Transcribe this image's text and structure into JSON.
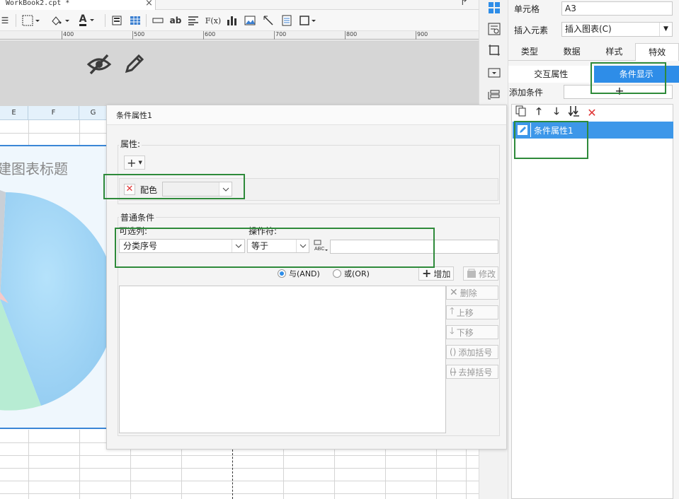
{
  "file_tab": {
    "name": "WorkBook2.cpt *",
    "close": "×"
  },
  "ruler": {
    "labels": [
      "400",
      "500",
      "600",
      "700",
      "800",
      "900"
    ]
  },
  "toolbar": {
    "ab_label": "ab",
    "fx_label": "F(x)",
    "font_color_label": "A"
  },
  "sheet": {
    "col_e": "E",
    "col_f": "F",
    "col_g": "G"
  },
  "chart": {
    "title": "建图表标题"
  },
  "right_panel": {
    "cell_label": "单元格",
    "cell_value": "A3",
    "insert_label": "插入元素",
    "insert_value": "插入图表(C)",
    "tabs": [
      "类型",
      "数据",
      "样式",
      "特效"
    ],
    "subtabs": [
      "交互属性",
      "条件显示"
    ],
    "add_condition_label": "添加条件",
    "add_condition_btn": "+",
    "condition_item": "条件属性1"
  },
  "dialog": {
    "title": "条件属性1",
    "attributes_legend": "属性:",
    "add_button": "+",
    "color_label": "配色",
    "normal_condition_legend": "普通条件",
    "column_label": "可选列:",
    "column_value": "分类序号",
    "operator_label": "操作符:",
    "operator_value": "等于",
    "value_input": "",
    "radio_and": "与(AND)",
    "radio_or": "或(OR)",
    "btn_add": "增加",
    "btn_modify": "修改",
    "btn_delete": "删除",
    "btn_up": "上移",
    "btn_down": "下移",
    "btn_add_bracket": "添加括号",
    "btn_remove_bracket": "去掉括号"
  },
  "colors": {
    "accent": "#2e8de8",
    "highlight": "#2e8a3a",
    "chart_border": "#3a86d6"
  }
}
